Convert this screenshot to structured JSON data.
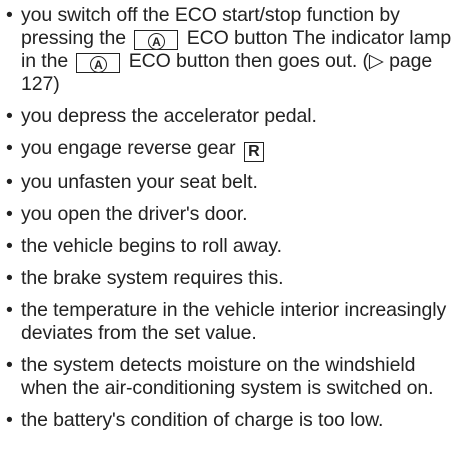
{
  "items": [
    {
      "prefix": "you switch off the ECO start/stop function by pressing the",
      "key1": "A",
      "middle": "ECO button The indicator lamp in the",
      "key2": "A",
      "suffix": "ECO button then goes out. (▷ page 127)"
    },
    {
      "text": "you depress the accelerator pedal."
    },
    {
      "prefix": "you engage reverse gear",
      "key": "R"
    },
    {
      "text": "you unfasten your seat belt."
    },
    {
      "text": "you open the driver's door."
    },
    {
      "text": "the vehicle begins to roll away."
    },
    {
      "text": "the brake system requires this."
    },
    {
      "text": "the temperature in the vehicle interior increasingly deviates from the set value."
    },
    {
      "text": "the system detects moisture on the windshield when the air-conditioning system is switched on."
    },
    {
      "text": "the battery's condition of charge is too low."
    }
  ]
}
